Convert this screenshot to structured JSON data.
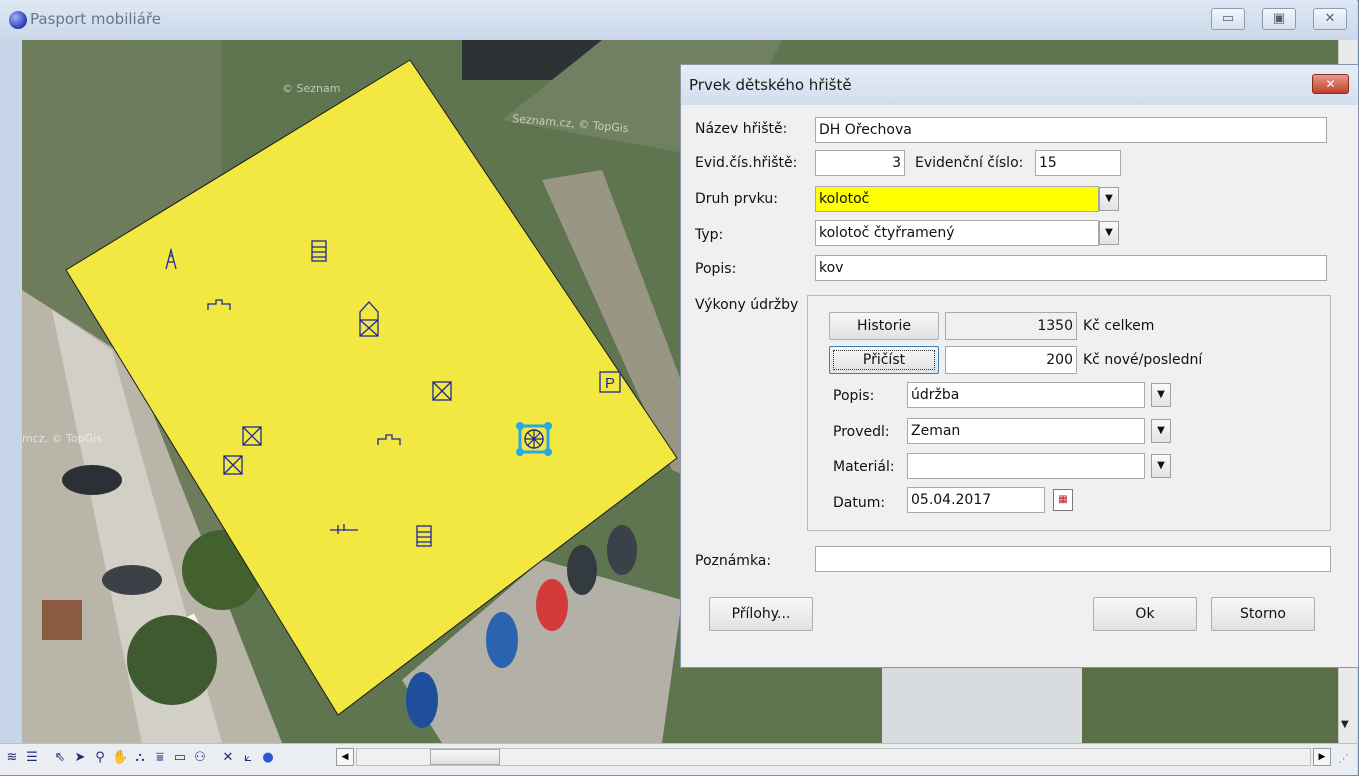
{
  "window": {
    "title": "Pasport mobiliáře",
    "minimize": "▭",
    "maximize": "▣",
    "close": "✕"
  },
  "map": {
    "watermarks": [
      "© Seznam",
      "Seznam.cz, © TopGis",
      "mcz, © TopGis"
    ],
    "polygon_fill": "#f3e741",
    "symbol_color": "#1a2a9a",
    "parking_symbol": "P",
    "selected_symbol_color": "#27a9e6"
  },
  "dialog": {
    "title": "Prvek dětského hřiště",
    "close": "✕",
    "nazev_label": "Název hřiště:",
    "nazev_value": "DH Ořechova",
    "evid_label": "Evid.čís.hřiště:",
    "evid_value": "3",
    "evidencni_label": "Evidenční číslo:",
    "evidencni_value": "15",
    "druh_label": "Druh prvku:",
    "druh_value": "kolotoč",
    "druh_highlight": "#ffff00",
    "typ_label": "Typ:",
    "typ_value": "kolotoč čtyřramený",
    "popis_label": "Popis:",
    "popis_value": "kov",
    "vykony_label": "Výkony údržby",
    "historie_label": "Historie",
    "historie_value": "1350",
    "kc_celkem": "Kč celkem",
    "pricist_label": "Přičíst",
    "pricist_value": "200",
    "kc_nove": "Kč nové/poslední",
    "m_popis_label": "Popis:",
    "m_popis_value": "údržba",
    "provedl_label": "Provedl:",
    "provedl_value": "Zeman",
    "material_label": "Materiál:",
    "material_value": "",
    "datum_label": "Datum:",
    "datum_value": "05.04.2017",
    "poznamka_label": "Poznámka:",
    "poznamka_value": "",
    "prilohy_label": "Přílohy...",
    "ok_label": "Ok",
    "storno_label": "Storno"
  },
  "toolbar": {
    "icons": [
      "layers-icon",
      "legend-icon",
      "select-arrow-icon",
      "pointer-icon",
      "zoom-icon",
      "pan-hand-icon",
      "measure-icon",
      "distance-icon",
      "rectangle-icon",
      "identify-icon",
      "snap-icon",
      "edit-vertices-icon",
      "point-icon"
    ],
    "glyphs": [
      "≋",
      "☰",
      "⇖",
      "➤",
      "⚲",
      "✋",
      "⛬",
      "⩸",
      "▭",
      "⚇",
      "✕",
      "⟀",
      "●"
    ]
  }
}
